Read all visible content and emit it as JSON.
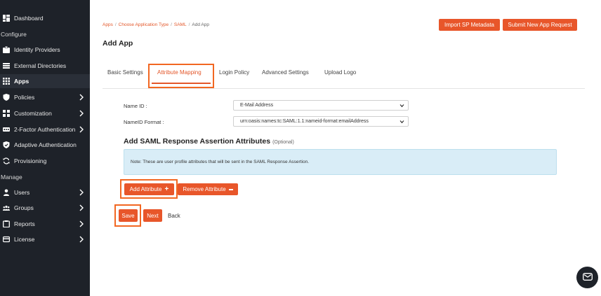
{
  "sidebar": {
    "items": [
      {
        "label": "Dashboard",
        "icon": "dashboard-icon",
        "chevron": false
      },
      {
        "label": "Identity Providers",
        "icon": "id-card-icon",
        "chevron": false
      },
      {
        "label": "External Directories",
        "icon": "list-icon",
        "chevron": false
      },
      {
        "label": "Apps",
        "icon": "grid-icon",
        "chevron": false,
        "active": true
      },
      {
        "label": "Policies",
        "icon": "shield-icon",
        "chevron": true
      },
      {
        "label": "Customization",
        "icon": "customize-icon",
        "chevron": true
      },
      {
        "label": "2-Factor Authentication",
        "icon": "2fa-icon",
        "chevron": true
      },
      {
        "label": "Adaptive Authentication",
        "icon": "shield-check-icon",
        "chevron": false
      },
      {
        "label": "Provisioning",
        "icon": "sync-icon",
        "chevron": false
      },
      {
        "label": "Users",
        "icon": "user-icon",
        "chevron": true
      },
      {
        "label": "Groups",
        "icon": "group-icon",
        "chevron": true
      },
      {
        "label": "Reports",
        "icon": "report-icon",
        "chevron": true
      },
      {
        "label": "License",
        "icon": "card-icon",
        "chevron": true
      }
    ],
    "sections": {
      "configure": "Configure",
      "manage": "Manage"
    }
  },
  "breadcrumb": {
    "apps": "Apps",
    "choose": "Choose Application Type",
    "saml": "SAML",
    "current": "Add App",
    "sep": "/"
  },
  "page_title": "Add App",
  "header_buttons": {
    "import": "Import SP Metadata",
    "submit": "Submit New App Request"
  },
  "tabs": [
    "Basic Settings",
    "Attribute Mapping",
    "Login Policy",
    "Advanced Settings",
    "Upload Logo"
  ],
  "active_tab": "Attribute Mapping",
  "form": {
    "name_id_label": "Name ID :",
    "name_id_value": "E-Mail Address",
    "nameid_format_label": "NameID Format :",
    "nameid_format_value": "urn:oasis:names:tc:SAML:1.1:nameid-format:emailAddress"
  },
  "section": {
    "title": "Add SAML Response Assertion Attributes",
    "optional": "(Optional)"
  },
  "note": "Note: These are user profile attributes that will be sent in the SAML Response Assertion.",
  "buttons": {
    "add_attribute": "Add Attribute",
    "remove_attribute": "Remove Attribute",
    "save": "Save",
    "next": "Next",
    "back": "Back"
  },
  "colors": {
    "accent": "#e8562a",
    "highlight": "#f26722",
    "sidebar_bg": "#1e2229",
    "note_bg": "#d9edf7"
  }
}
